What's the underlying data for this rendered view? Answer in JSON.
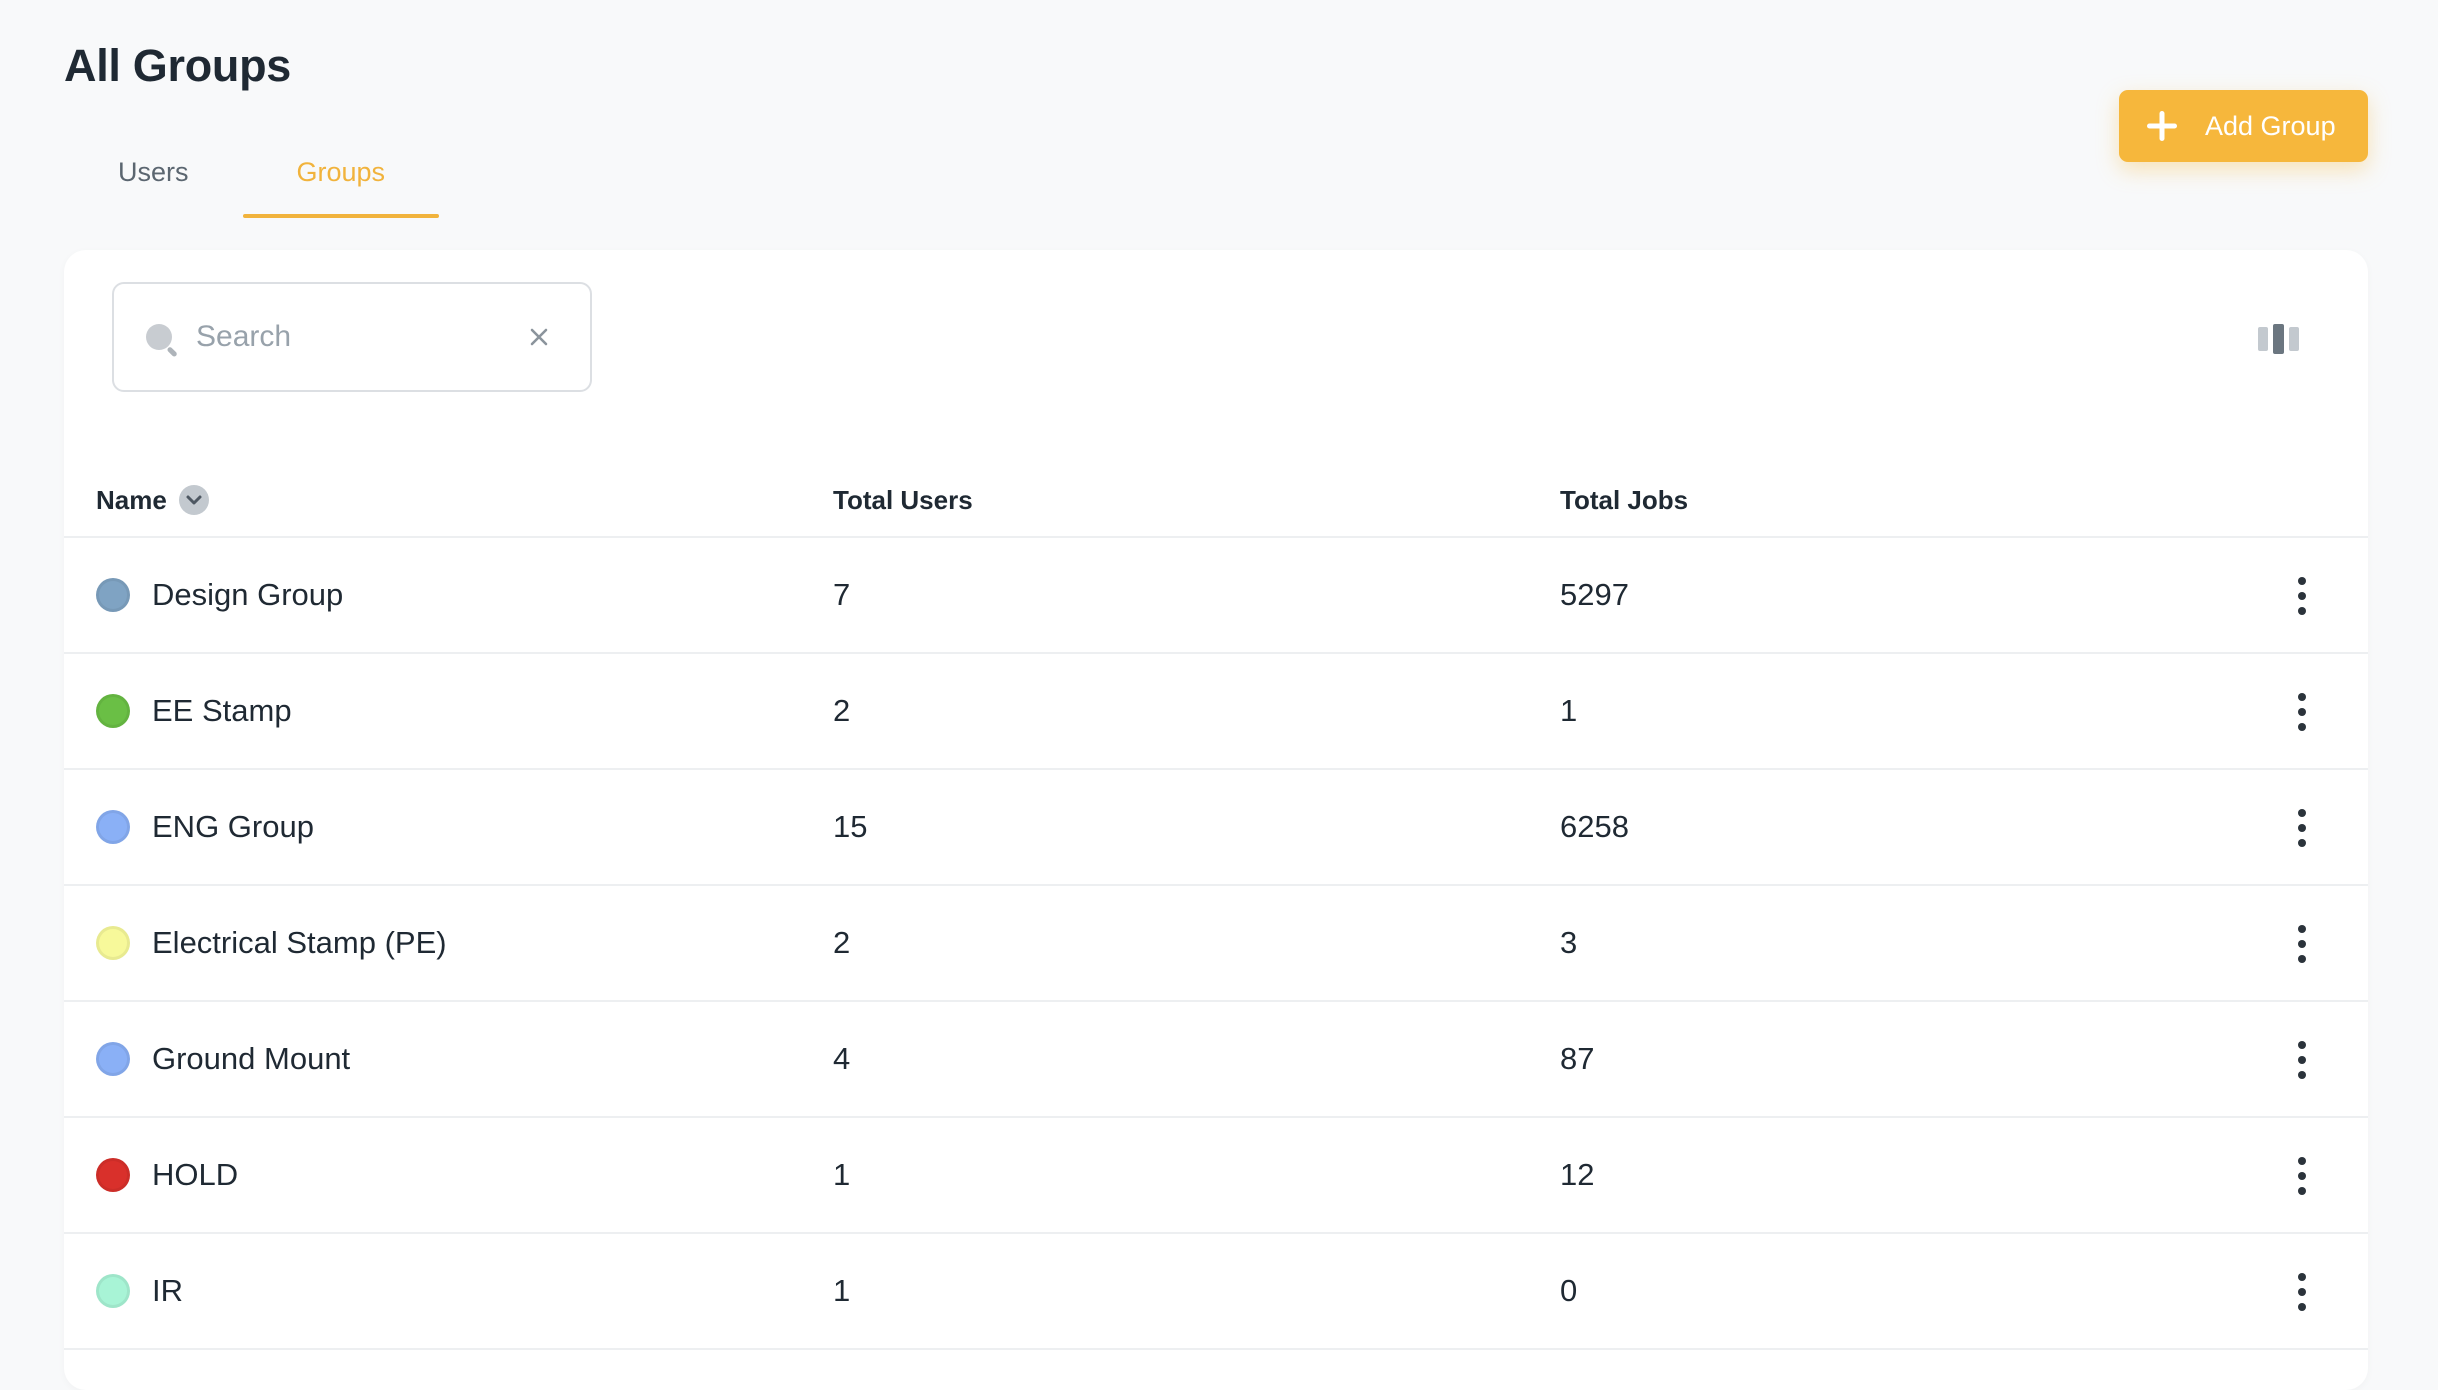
{
  "page": {
    "title": "All Groups"
  },
  "tabs": [
    {
      "label": "Users",
      "active": false
    },
    {
      "label": "Groups",
      "active": true
    }
  ],
  "toolbar": {
    "add_label": "Add Group"
  },
  "search": {
    "placeholder": "Search",
    "value": ""
  },
  "table": {
    "columns": {
      "name": "Name",
      "total_users": "Total Users",
      "total_jobs": "Total Jobs"
    },
    "rows": [
      {
        "name": "Design Group",
        "total_users": "7",
        "total_jobs": "5297",
        "color": "#7fa3c3"
      },
      {
        "name": "EE Stamp",
        "total_users": "2",
        "total_jobs": "1",
        "color": "#6abf45"
      },
      {
        "name": "ENG Group",
        "total_users": "15",
        "total_jobs": "6258",
        "color": "#8ab0f6"
      },
      {
        "name": "Electrical Stamp (PE)",
        "total_users": "2",
        "total_jobs": "3",
        "color": "#f7f99a"
      },
      {
        "name": "Ground Mount",
        "total_users": "4",
        "total_jobs": "87",
        "color": "#8ab0f6"
      },
      {
        "name": "HOLD",
        "total_users": "1",
        "total_jobs": "12",
        "color": "#d9302b"
      },
      {
        "name": "IR",
        "total_users": "1",
        "total_jobs": "0",
        "color": "#a8f4d6"
      }
    ]
  },
  "colors": {
    "accent": "#f6b73c",
    "text": "#1f2933",
    "muted": "#98a2ab"
  },
  "icons": {
    "add": "plus-icon",
    "search": "search-icon",
    "clear": "close-icon",
    "columns": "columns-icon",
    "sort": "chevron-down-icon",
    "row_menu": "more-vertical-icon"
  }
}
